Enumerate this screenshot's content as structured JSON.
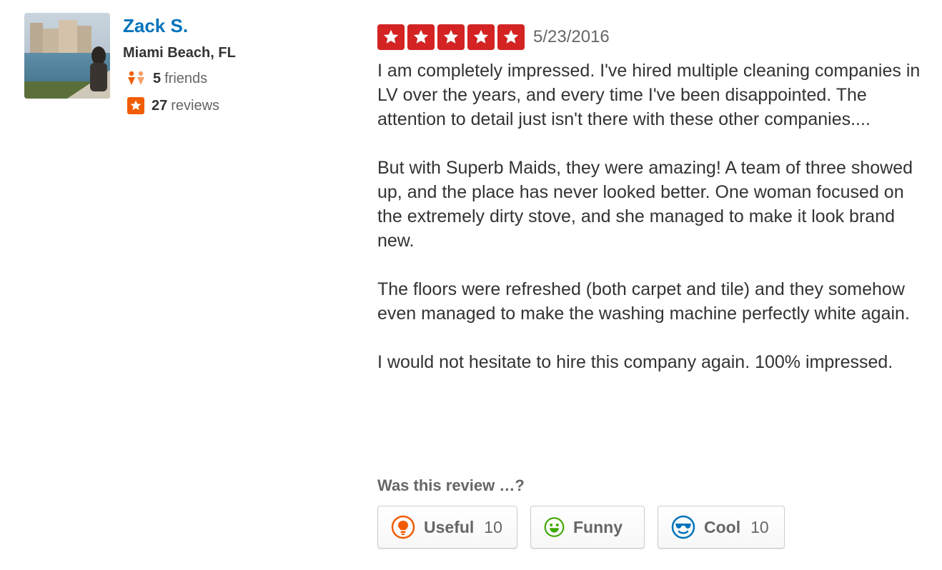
{
  "user": {
    "name": "Zack S.",
    "location": "Miami Beach, FL",
    "friends_count": "5",
    "friends_label": "friends",
    "reviews_count": "27",
    "reviews_label": "reviews"
  },
  "review": {
    "rating": 5,
    "max_rating": 5,
    "date": "5/23/2016",
    "paragraphs": [
      "I am completely impressed. I've hired multiple cleaning companies in LV over the years, and every time I've been disappointed. The attention to detail just isn't there with these other companies....",
      "But with Superb Maids, they were amazing! A team of three showed up, and the place has never looked better. One woman focused on the extremely dirty stove, and she managed to make it look brand new.",
      "The floors were refreshed (both carpet and tile) and they somehow even managed to make the washing machine perfectly white again.",
      "I would not hesitate to hire this company again. 100% impressed."
    ]
  },
  "votes": {
    "question": "Was this review …?",
    "useful": {
      "label": "Useful",
      "count": "10",
      "icon": "lightbulb-icon"
    },
    "funny": {
      "label": "Funny",
      "count": "",
      "icon": "smiley-icon"
    },
    "cool": {
      "label": "Cool",
      "count": "10",
      "icon": "sunglasses-icon"
    }
  },
  "colors": {
    "link": "#0073bb",
    "star": "#d32323",
    "friends_icon": "#f15c00",
    "reviews_icon": "#f15c00",
    "useful": "#f15c00",
    "funny": "#41a700",
    "cool": "#0073bb"
  }
}
